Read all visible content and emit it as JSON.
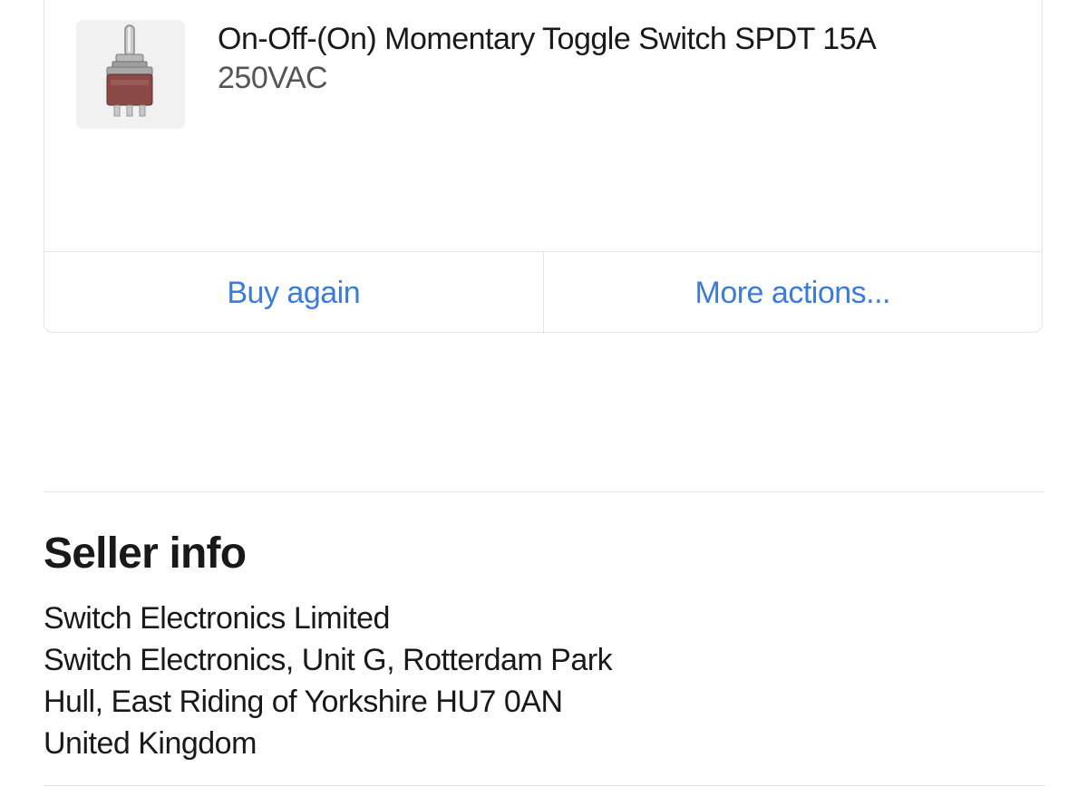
{
  "item": {
    "title_line1": "On-Off-(On) Momentary Toggle Switch SPDT 15A",
    "title_line2": "250VAC",
    "image_icon": "toggle-switch-product-image",
    "actions": {
      "buy_again": "Buy again",
      "more_actions": "More actions..."
    }
  },
  "seller": {
    "heading": "Seller info",
    "name": "Switch Electronics Limited",
    "address_line1": "Switch Electronics, Unit G, Rotterdam Park",
    "address_line2": "Hull, East Riding of Yorkshire HU7 0AN",
    "country": "United Kingdom"
  },
  "colors": {
    "link": "#3b7bdb",
    "text": "#191919",
    "border": "#e5e5e5"
  }
}
